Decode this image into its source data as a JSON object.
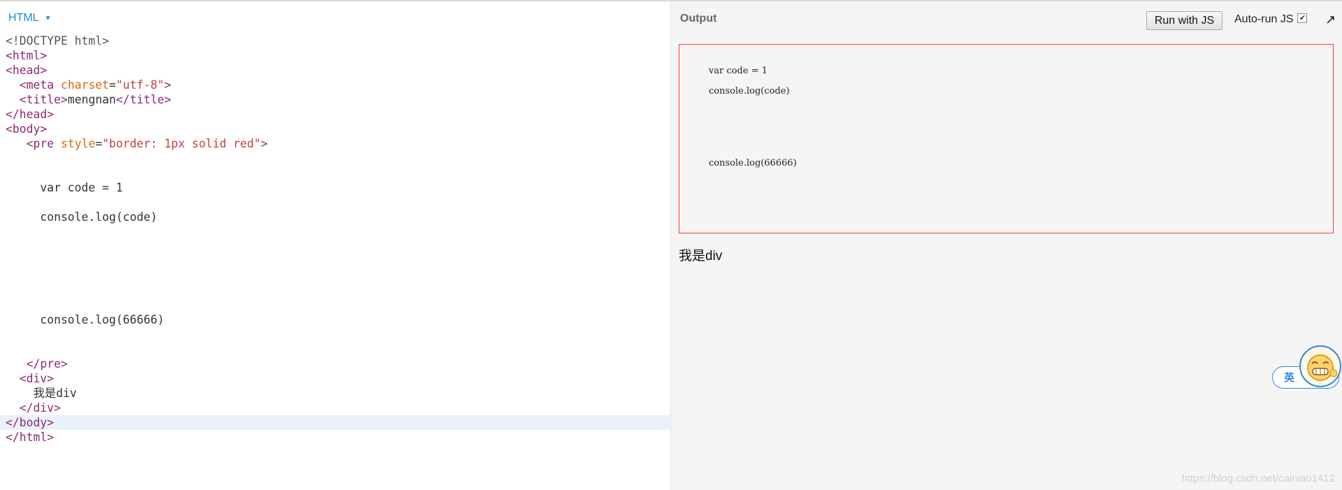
{
  "editor": {
    "language": "HTML",
    "lines": [
      "<!DOCTYPE html>",
      "<html>",
      "<head>",
      "  <meta charset=\"utf-8\">",
      "  <title>mengnan</title>",
      "</head>",
      "<body>",
      "   <pre style=\"border: 1px solid red\">",
      "",
      "",
      "     var code = 1",
      "",
      "     console.log(code)",
      "",
      "",
      "",
      "",
      "",
      "",
      "     console.log(66666)",
      "",
      "",
      "   </pre>",
      "  <div>",
      "    我是div",
      "  </div>",
      "</body>",
      "</html>"
    ],
    "active_line": 27
  },
  "output": {
    "title": "Output",
    "run_button": "Run with JS",
    "autorun_label": "Auto-run JS",
    "autorun_checked": true,
    "checkbox_mark": "✔",
    "expand_glyph": "↗",
    "pre_lines": [
      "var code = 1",
      "console.log(code)",
      "console.log(66666)"
    ],
    "div_text": "我是div"
  },
  "ime_widget": {
    "label": "英"
  },
  "watermark": "https://blog.csdn.net/cainiao1412",
  "colors": {
    "tag": "#8c2a6e",
    "attr": "#d36a16",
    "string": "#c4403e",
    "pre_border": "#ff3b3b",
    "accent": "#1a8fd6"
  }
}
